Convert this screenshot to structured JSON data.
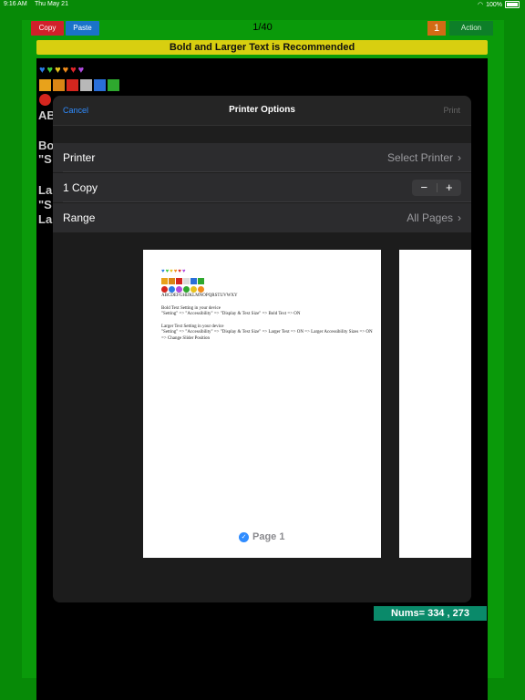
{
  "status": {
    "time": "9:16 AM",
    "date": "Thu May 21",
    "battery": "100%"
  },
  "toolbar": {
    "copy": "Copy",
    "paste": "Paste",
    "counter": "1/40",
    "one": "1",
    "action": "Action"
  },
  "banner": "Bold and Larger Text is Recommended",
  "background_text": {
    "line1": "AB",
    "line2": "Bo",
    "line3": "\"S",
    "line4": "La",
    "line5": "\"S",
    "line6": "La"
  },
  "nums": "Nums= 334 , 273",
  "dialog": {
    "cancel": "Cancel",
    "title": "Printer Options",
    "print": "Print",
    "printer_label": "Printer",
    "printer_value": "Select Printer",
    "copies_label": "1 Copy",
    "minus": "−",
    "plus": "+",
    "range_label": "Range",
    "range_value": "All Pages"
  },
  "preview": {
    "alphabet": "ABCDEFGHIJKLMNOPQRSTUVWXY",
    "bold_title": "Bold Text Setting in your device",
    "bold_path": "\"Setting\" => \"Accessibility\" => \"Display & Text Size\" => Bold Text => ON",
    "larger_title": "Larger Text Setting in your device",
    "larger_path": "\"Setting\" => \"Accessibility\" => \"Display & Text Size\" => Larger Text => ON => Larger Accessibility Sizes => ON => Change Slider Position",
    "page_label": "Page 1"
  },
  "colors": {
    "hearts": [
      "#2a7be4",
      "#3ecc3e",
      "#e8c21d",
      "#f28c1b",
      "#e0252a",
      "#b04adf"
    ],
    "squares": [
      "#e8a21b",
      "#d98515",
      "#d4261e",
      "#b8b8b8",
      "#2a6fd8",
      "#2ea82e"
    ]
  }
}
